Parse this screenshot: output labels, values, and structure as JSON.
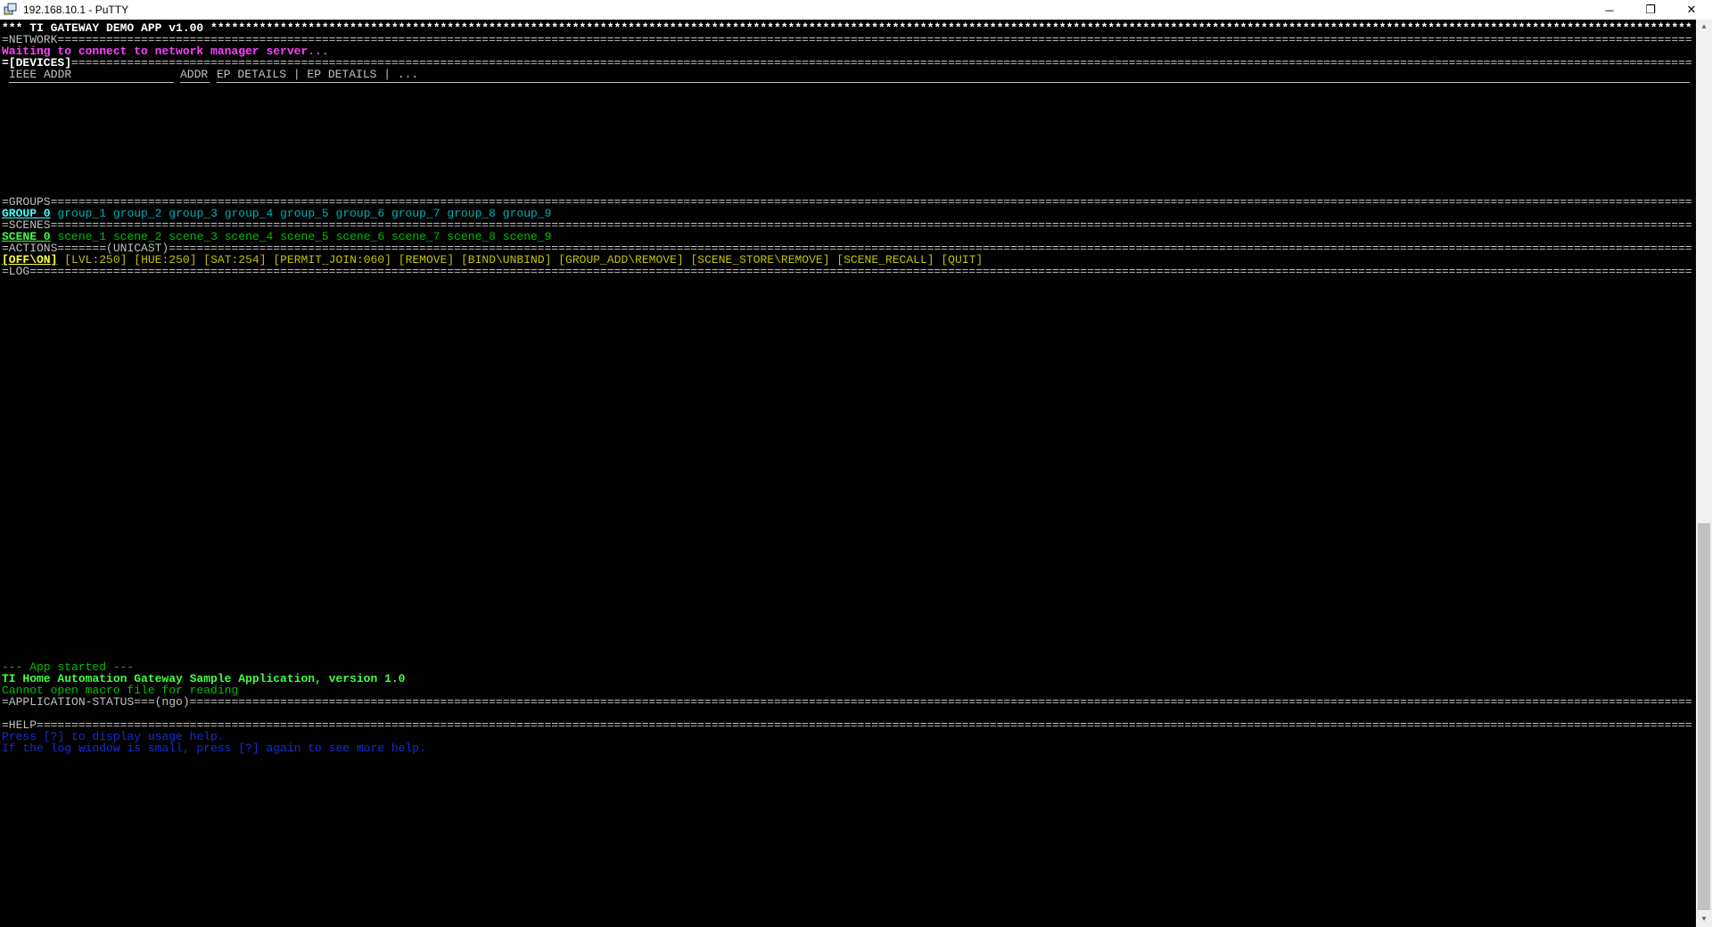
{
  "window": {
    "title": "192.168.10.1 - PuTTY",
    "minimize": "─",
    "restore": "❐",
    "close": "✕"
  },
  "terminal": {
    "header": "*** TI GATEWAY DEMO APP v1.00 ",
    "network_label": "=NETWORK",
    "network_status": "Waiting to connect to network manager server...",
    "devices_label": "=[DEVICES]",
    "device_columns": {
      "ieee": "IEEE ADDR",
      "addr": "ADDR",
      "ep": "EP DETAILS | EP DETAILS | ..."
    },
    "groups_label": "=GROUPS",
    "groups": [
      "GROUP 0",
      "group_1",
      "group_2",
      "group_3",
      "group_4",
      "group_5",
      "group_6",
      "group_7",
      "group_8",
      "group_9"
    ],
    "scenes_label": "=SCENES",
    "scenes": [
      "SCENE 0",
      "scene_1",
      "scene_2",
      "scene_3",
      "scene_4",
      "scene_5",
      "scene_6",
      "scene_7",
      "scene_8",
      "scene_9"
    ],
    "actions_label": "=ACTIONS=======(UNICAST)",
    "actions": {
      "off_on": "[OFF\\ON]",
      "lvl": "[LVL:250]",
      "hue": "[HUE:250]",
      "sat": "[SAT:254]",
      "permit_join": "[PERMIT_JOIN:060]",
      "remove": "[REMOVE]",
      "bind": "[BIND\\UNBIND]",
      "group_add": "[GROUP_ADD\\REMOVE]",
      "scene_store": "[SCENE_STORE\\REMOVE]",
      "scene_recall": "[SCENE_RECALL]",
      "quit": "[QUIT]"
    },
    "log_label": "=LOG",
    "log_lines": [
      "--- App started ---",
      "TI Home Automation Gateway Sample Application, version 1.0",
      "Cannot open macro file for reading"
    ],
    "app_status_label": "=APPLICATION-STATUS===(ngo)",
    "help_label": "=HELP",
    "help_lines": [
      "Press [?] to display usage help.",
      "If the log window is small, press [?] again to see more help."
    ]
  },
  "colors": {
    "background": "#000000",
    "default_text": "#c0c0c0",
    "magenta": "#c000c0",
    "cyan": "#00b0b0",
    "green": "#00c000",
    "yellow": "#c0c000",
    "blue": "#1030d8"
  }
}
